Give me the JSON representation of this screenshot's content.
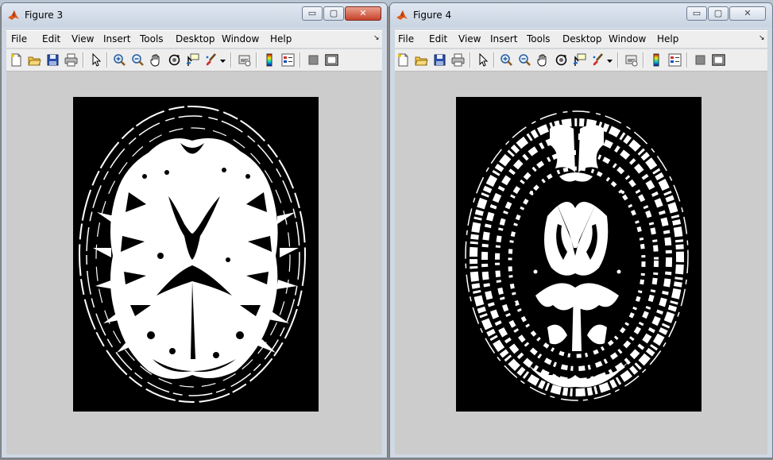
{
  "windows": [
    {
      "title": "Figure 3",
      "menu": [
        "File",
        "Edit",
        "View",
        "Insert",
        "Tools",
        "Desktop",
        "Window",
        "Help"
      ],
      "close_symbol": "✕",
      "minimize_symbol": "▭",
      "maximize_symbol": "▢",
      "menu_overflow_symbol": "↘",
      "image_icon": "mri-brain-segmentation-white-matter",
      "active": true
    },
    {
      "title": "Figure 4",
      "menu": [
        "File",
        "Edit",
        "View",
        "Insert",
        "Tools",
        "Desktop",
        "Window",
        "Help"
      ],
      "close_symbol": "✕",
      "minimize_symbol": "▭",
      "maximize_symbol": "▢",
      "menu_overflow_symbol": "↘",
      "image_icon": "mri-brain-segmentation-gray-matter",
      "active": false
    }
  ],
  "toolbar_icons": [
    "new-figure-icon",
    "open-file-icon",
    "save-icon",
    "print-icon",
    "edit-plot-arrow-icon",
    "zoom-in-icon",
    "zoom-out-icon",
    "pan-hand-icon",
    "rotate-3d-icon",
    "data-cursor-icon",
    "brush-icon",
    "brush-dropdown-icon",
    "link-plot-icon",
    "insert-colorbar-icon",
    "insert-legend-icon",
    "hide-plot-tools-icon",
    "show-plot-tools-icon"
  ],
  "colors": {
    "active_close": "#c8432b",
    "matlab_logo": "#e05a1a",
    "canvas": "#cccccc"
  }
}
